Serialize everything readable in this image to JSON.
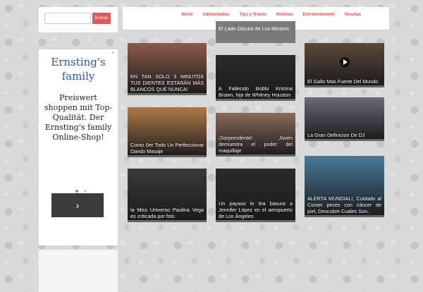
{
  "search": {
    "placeholder": "",
    "button_label": "Buscar"
  },
  "ad": {
    "title": "Ernsting's family",
    "text": "Preiswert shoppen mit Top-Qualität. Der Ernsting's family Online-Shop!",
    "close_icon": "close-icon",
    "arrow_icon": "chevron-right-icon",
    "arrow_glyph": "›",
    "close_glyph": "×"
  },
  "nav": {
    "items": [
      "Inicio",
      "Curiosidades",
      "Tips y Trucos",
      "Noticias",
      "Entretenimiento",
      "Resetas"
    ],
    "color": "#e14c4c"
  },
  "header_post": {
    "caption": "El Lado Oscuro de Los Minions"
  },
  "posts": [
    {
      "caption": "EN TAN SOLO 3 MINUTOS TUS DIENTES ESTARÁN MÁS BLANCOS QUE NUNCA!",
      "color": "#8a5a4a"
    },
    {
      "caption": "A Fallecido Bobbi Kristina Brown, hija de Whitney Houston",
      "color": "#2a2a2a"
    },
    {
      "caption": "El Gallo Mas Fuerte Del Mundo",
      "color": "#5a4a3a"
    },
    {
      "caption": "Como Ser Todo Un Perfeccionar Dando Masaje",
      "color": "#b07a4a"
    },
    {
      "caption": "¡Sorprendente! Joven demuestra el poder del maquillaje",
      "color": "#8a6a5a"
    },
    {
      "caption": "La Gran Definicion De DJ",
      "color": "#6a6a7a"
    },
    {
      "caption": "la Miss Universo Paulina Vega es criticada por foto",
      "color": "#3a3a3a"
    },
    {
      "caption": "Un payaso le tira basura a Jennifer López en el aeropuerto de Los Ángeles",
      "color": "#2a2a2a"
    },
    {
      "caption": "ALERTA MUNDIAL!, Cuidado al Comer peces con cáncer de piel, Descubre Cuales Son..",
      "color": "#4a7a9a"
    }
  ]
}
